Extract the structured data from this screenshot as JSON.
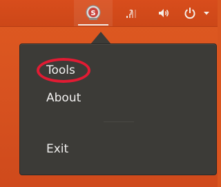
{
  "panel": {
    "indicators": [
      {
        "name": "app-indicator-icon",
        "label": "S"
      },
      {
        "name": "network-icon",
        "label": "?"
      },
      {
        "name": "volume-icon",
        "label": ""
      },
      {
        "name": "power-icon",
        "label": ""
      }
    ]
  },
  "menu": {
    "items": [
      {
        "label": "Tools"
      },
      {
        "label": "About"
      },
      {
        "label": "Exit"
      }
    ]
  },
  "colors": {
    "panel": "#d84d1c",
    "wallpaper": "#d9551f",
    "menu_bg": "#3c3b37",
    "menu_text": "#f2f1f0",
    "highlight": "#e21b33"
  }
}
